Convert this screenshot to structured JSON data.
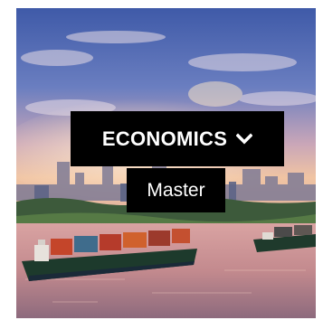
{
  "category_menu": {
    "selected_label": "ECONOMICS",
    "toggle_icon": "chevron-down-icon",
    "options": [
      {
        "label": "Master"
      }
    ]
  },
  "colors": {
    "menu_background": "#000000",
    "menu_text": "#ffffff",
    "sky_top": "#4a5fa8",
    "sky_glow": "#f3c9a8",
    "water": "#c98a86",
    "ship_container_red": "#c44a2a",
    "ship_hull": "#1e3b2a"
  }
}
